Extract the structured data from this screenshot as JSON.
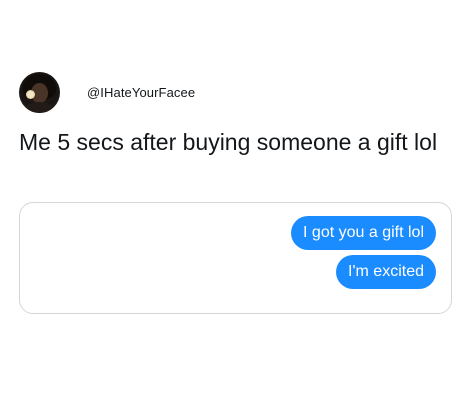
{
  "tweet": {
    "username": "@IHateYourFacee",
    "text": "Me 5 secs after buying someone a gift lol"
  },
  "conversation": {
    "messages": [
      {
        "text": "I got you a gift lol",
        "sender": "me"
      },
      {
        "text": "I'm excited",
        "sender": "me"
      }
    ],
    "bubble_color": "#1a8cff"
  },
  "icons": {
    "avatar": "profile-photo-avatar"
  }
}
